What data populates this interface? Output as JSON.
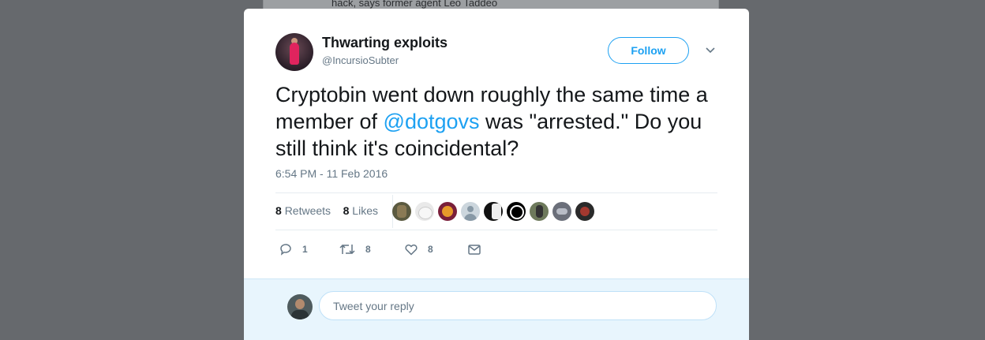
{
  "background": {
    "partial_headline": "hack, says former agent Leo Taddeo"
  },
  "tweet": {
    "author_name": "Thwarting exploits",
    "author_handle": "@IncursioSubter",
    "follow_label": "Follow",
    "text_before": "Cryptobin went down roughly the same time a member of ",
    "mention": "@dotgovs",
    "text_after": " was \"arrested.\" Do you still think it's coincidental?",
    "timestamp": "6:54 PM - 11 Feb 2016",
    "retweet_count": "8",
    "retweet_label": "Retweets",
    "like_count": "8",
    "like_label": "Likes",
    "liker_avatars": [
      "avatar-1",
      "avatar-2",
      "avatar-3",
      "avatar-4",
      "avatar-5",
      "avatar-6",
      "avatar-7",
      "avatar-8",
      "avatar-9"
    ],
    "actions": {
      "reply_count": "1",
      "retweet_count": "8",
      "like_count": "8"
    }
  },
  "reply": {
    "placeholder": "Tweet your reply"
  },
  "colors": {
    "accent": "#1da1f2",
    "text": "#14171a",
    "muted": "#657786",
    "overlay": "#66696d",
    "reply_bg": "#e8f5fd"
  }
}
